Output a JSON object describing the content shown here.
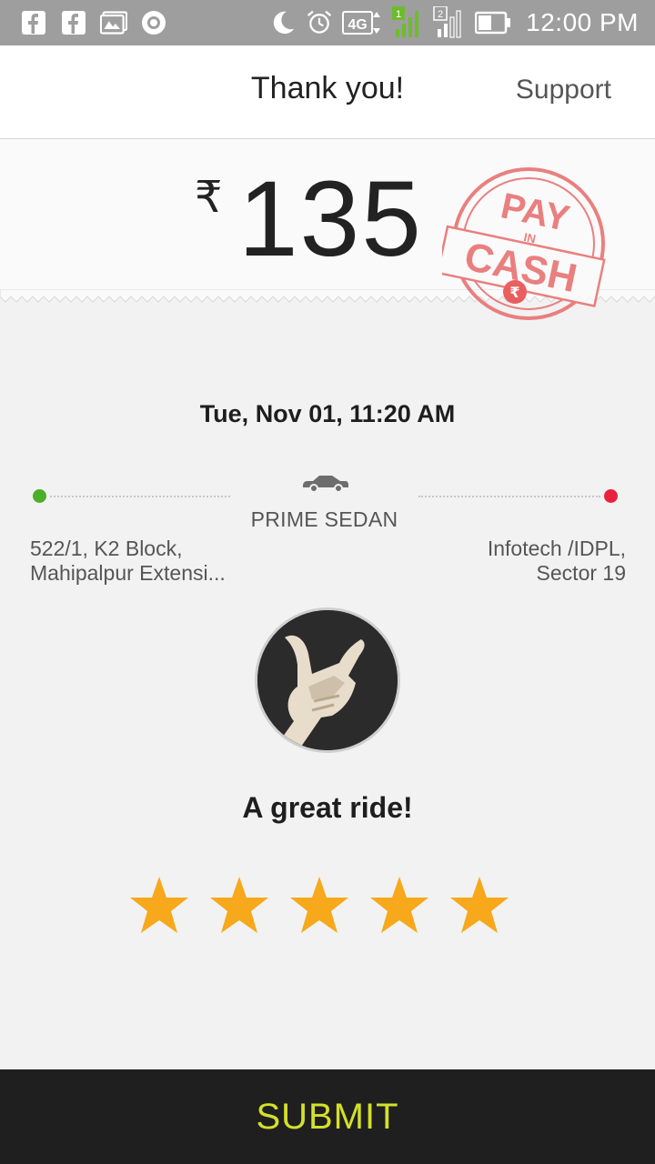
{
  "status_bar": {
    "time": "12:00 PM",
    "network": "4G",
    "sim1": "1",
    "sim2": "2",
    "icons": [
      "facebook-icon",
      "facebook-icon",
      "gallery-icon",
      "record-icon",
      "moon-icon",
      "alarm-icon",
      "network-4g-icon",
      "signal-sim1-icon",
      "signal-sim2-icon",
      "battery-icon"
    ]
  },
  "header": {
    "title": "Thank you!",
    "support_label": "Support"
  },
  "fare": {
    "currency": "₹",
    "amount": "135",
    "stamp": {
      "line1": "PAY",
      "line2": "IN",
      "line3": "CASH",
      "symbol": "₹"
    }
  },
  "ride": {
    "date": "Tue, Nov 01, 11:20 AM",
    "cab_type": "PRIME SEDAN",
    "from": {
      "line1": "522/1, K2 Block,",
      "line2": "Mahipalpur Extensi..."
    },
    "to": {
      "line1": "Infotech /IDPL,",
      "line2": "Sector 19"
    }
  },
  "rating": {
    "feedback": "A great ride!",
    "stars": 5,
    "max_stars": 5
  },
  "submit_label": "SUBMIT",
  "colors": {
    "start_dot": "#4caf2a",
    "end_dot": "#e8223d",
    "star": "#f7a81b",
    "submit_text": "#d4e02a",
    "stamp": "#e86a6a"
  }
}
